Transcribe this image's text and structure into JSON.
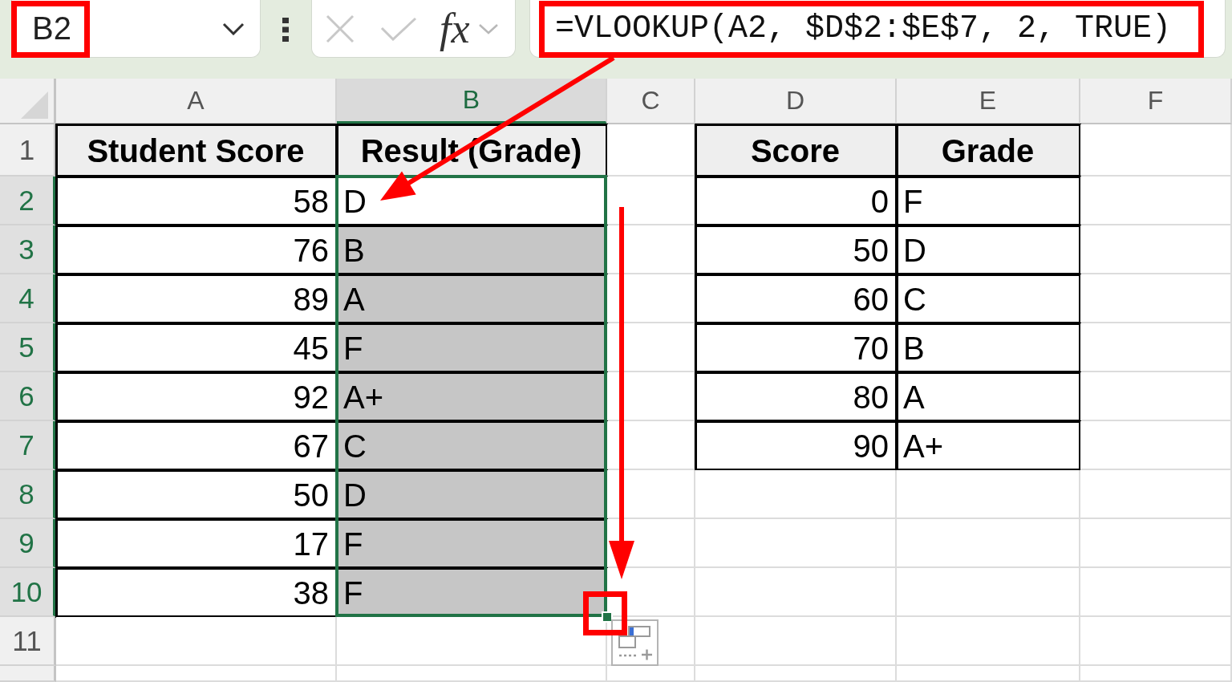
{
  "name_box": {
    "value": "B2",
    "highlighted": true
  },
  "formula_bar": {
    "editing": false,
    "function_label": "fx",
    "formula": "=VLOOKUP(A2, $D$2:$E$7, 2, TRUE)",
    "highlighted": true,
    "arrow_to_cell": true
  },
  "sheet": {
    "columns": [
      {
        "label": "A",
        "selected": false
      },
      {
        "label": "B",
        "selected": true
      },
      {
        "label": "C",
        "selected": false
      },
      {
        "label": "D",
        "selected": false
      },
      {
        "label": "E",
        "selected": false
      },
      {
        "label": "F",
        "selected": false
      }
    ],
    "rows": [
      {
        "label": "1",
        "selected": false,
        "cells": [
          {
            "kind": "header",
            "text": "Student Score",
            "bordered": true,
            "selected": false
          },
          {
            "kind": "header",
            "text": "Result (Grade)",
            "bordered": true,
            "selected": false
          },
          {
            "bordered": false,
            "selected": false
          },
          {
            "kind": "header",
            "text": "Score",
            "bordered": true,
            "selected": false
          },
          {
            "kind": "header",
            "text": "Grade",
            "bordered": true,
            "selected": false
          },
          {
            "bordered": false,
            "selected": false
          }
        ]
      },
      {
        "label": "2",
        "selected": true,
        "cells": [
          {
            "kind": "number",
            "text": "58",
            "bordered": true,
            "selected": false
          },
          {
            "kind": "text",
            "text": "D",
            "bordered": true,
            "selected": false
          },
          {
            "bordered": false,
            "selected": false
          },
          {
            "kind": "number",
            "text": "0",
            "bordered": true,
            "selected": false
          },
          {
            "kind": "text",
            "text": "F",
            "bordered": true,
            "selected": false
          },
          {
            "bordered": false,
            "selected": false
          }
        ]
      },
      {
        "label": "3",
        "selected": true,
        "cells": [
          {
            "kind": "number",
            "text": "76",
            "bordered": true,
            "selected": false
          },
          {
            "kind": "text",
            "text": "B",
            "bordered": true,
            "selected": true
          },
          {
            "bordered": false,
            "selected": false
          },
          {
            "kind": "number",
            "text": "50",
            "bordered": true,
            "selected": false
          },
          {
            "kind": "text",
            "text": "D",
            "bordered": true,
            "selected": false
          },
          {
            "bordered": false,
            "selected": false
          }
        ]
      },
      {
        "label": "4",
        "selected": true,
        "cells": [
          {
            "kind": "number",
            "text": "89",
            "bordered": true,
            "selected": false
          },
          {
            "kind": "text",
            "text": "A",
            "bordered": true,
            "selected": true
          },
          {
            "bordered": false,
            "selected": false
          },
          {
            "kind": "number",
            "text": "60",
            "bordered": true,
            "selected": false
          },
          {
            "kind": "text",
            "text": "C",
            "bordered": true,
            "selected": false
          },
          {
            "bordered": false,
            "selected": false
          }
        ]
      },
      {
        "label": "5",
        "selected": true,
        "cells": [
          {
            "kind": "number",
            "text": "45",
            "bordered": true,
            "selected": false
          },
          {
            "kind": "text",
            "text": "F",
            "bordered": true,
            "selected": true
          },
          {
            "bordered": false,
            "selected": false
          },
          {
            "kind": "number",
            "text": "70",
            "bordered": true,
            "selected": false
          },
          {
            "kind": "text",
            "text": "B",
            "bordered": true,
            "selected": false
          },
          {
            "bordered": false,
            "selected": false
          }
        ]
      },
      {
        "label": "6",
        "selected": true,
        "cells": [
          {
            "kind": "number",
            "text": "92",
            "bordered": true,
            "selected": false
          },
          {
            "kind": "text",
            "text": "A+",
            "bordered": true,
            "selected": true
          },
          {
            "bordered": false,
            "selected": false
          },
          {
            "kind": "number",
            "text": "80",
            "bordered": true,
            "selected": false
          },
          {
            "kind": "text",
            "text": "A",
            "bordered": true,
            "selected": false
          },
          {
            "bordered": false,
            "selected": false
          }
        ]
      },
      {
        "label": "7",
        "selected": true,
        "cells": [
          {
            "kind": "number",
            "text": "67",
            "bordered": true,
            "selected": false
          },
          {
            "kind": "text",
            "text": "C",
            "bordered": true,
            "selected": true
          },
          {
            "bordered": false,
            "selected": false
          },
          {
            "kind": "number",
            "text": "90",
            "bordered": true,
            "selected": false
          },
          {
            "kind": "text",
            "text": "A+",
            "bordered": true,
            "selected": false
          },
          {
            "bordered": false,
            "selected": false
          }
        ]
      },
      {
        "label": "8",
        "selected": true,
        "cells": [
          {
            "kind": "number",
            "text": "50",
            "bordered": true,
            "selected": false
          },
          {
            "kind": "text",
            "text": "D",
            "bordered": true,
            "selected": true
          },
          {
            "bordered": false,
            "selected": false
          },
          {
            "bordered": false,
            "selected": false
          },
          {
            "bordered": false,
            "selected": false
          },
          {
            "bordered": false,
            "selected": false
          }
        ]
      },
      {
        "label": "9",
        "selected": true,
        "cells": [
          {
            "kind": "number",
            "text": "17",
            "bordered": true,
            "selected": false
          },
          {
            "kind": "text",
            "text": "F",
            "bordered": true,
            "selected": true
          },
          {
            "bordered": false,
            "selected": false
          },
          {
            "bordered": false,
            "selected": false
          },
          {
            "bordered": false,
            "selected": false
          },
          {
            "bordered": false,
            "selected": false
          }
        ]
      },
      {
        "label": "10",
        "selected": true,
        "cells": [
          {
            "kind": "number",
            "text": "38",
            "bordered": true,
            "selected": false
          },
          {
            "kind": "text",
            "text": "F",
            "bordered": true,
            "selected": true
          },
          {
            "bordered": false,
            "selected": false
          },
          {
            "bordered": false,
            "selected": false
          },
          {
            "bordered": false,
            "selected": false
          },
          {
            "bordered": false,
            "selected": false
          }
        ]
      },
      {
        "label": "11",
        "selected": false,
        "cells": [
          {
            "bordered": false,
            "selected": false
          },
          {
            "bordered": false,
            "selected": false
          },
          {
            "bordered": false,
            "selected": false
          },
          {
            "bordered": false,
            "selected": false
          },
          {
            "bordered": false,
            "selected": false
          },
          {
            "bordered": false,
            "selected": false
          }
        ]
      }
    ]
  },
  "fill_handle": {
    "highlighted": true,
    "drag_arrow": true
  }
}
